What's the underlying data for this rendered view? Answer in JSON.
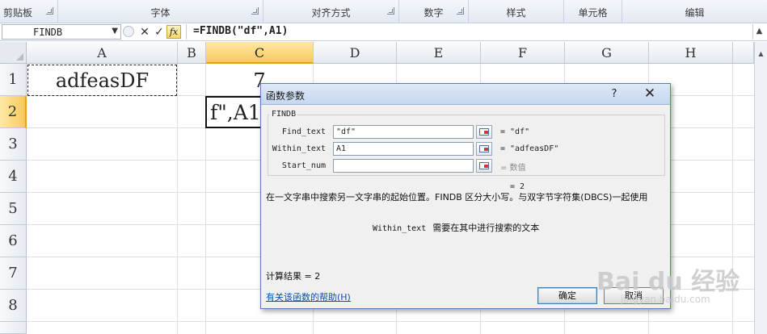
{
  "ribbon": {
    "groups": [
      {
        "label": "剪贴板"
      },
      {
        "label": "字体"
      },
      {
        "label": "对齐方式"
      },
      {
        "label": "数字"
      },
      {
        "label": "样式"
      },
      {
        "label": "单元格"
      },
      {
        "label": "编辑"
      }
    ]
  },
  "formula_bar": {
    "name_box": "FINDB",
    "cancel_icon": "✕",
    "enter_icon": "✓",
    "fx_label": "fx",
    "formula": "=FINDB(\"df\",A1)"
  },
  "sheet": {
    "columns": [
      "A",
      "B",
      "C",
      "D",
      "E",
      "F",
      "G",
      "H"
    ],
    "selected_column": "C",
    "rows": [
      "1",
      "2",
      "3",
      "4",
      "5",
      "6",
      "7",
      "8"
    ],
    "selected_row": "2",
    "cells": {
      "A1": "adfeasDF",
      "C1": "7",
      "C2_edit": "f\",A1)"
    }
  },
  "dialog": {
    "title": "函数参数",
    "help_button": "?",
    "close_button": "✕",
    "function_name": "FINDB",
    "args": [
      {
        "label": "Find_text",
        "value": "\"df\"",
        "result": "= \"df\"",
        "result_gray": false
      },
      {
        "label": "Within_text",
        "value": "A1",
        "result": "= \"adfeasDF\"",
        "result_gray": false
      },
      {
        "label": "Start_num",
        "value": "",
        "result": "= 数值",
        "result_gray": true
      }
    ],
    "formula_result_top": "= 2",
    "description": "在一文字串中搜索另一文字串的起始位置。FINDB 区分大小写。与双字节字符集(DBCS)一起使用",
    "arg_description_name": "Within_text",
    "arg_description_text": "需要在其中进行搜索的文本",
    "calc_result": "计算结果 = 2",
    "help_link": "有关该函数的帮助(H)",
    "ok": "确定",
    "cancel": "取消"
  },
  "watermark": {
    "line1": "Bai du 经验",
    "line2": "jingyan.baidu.com"
  }
}
